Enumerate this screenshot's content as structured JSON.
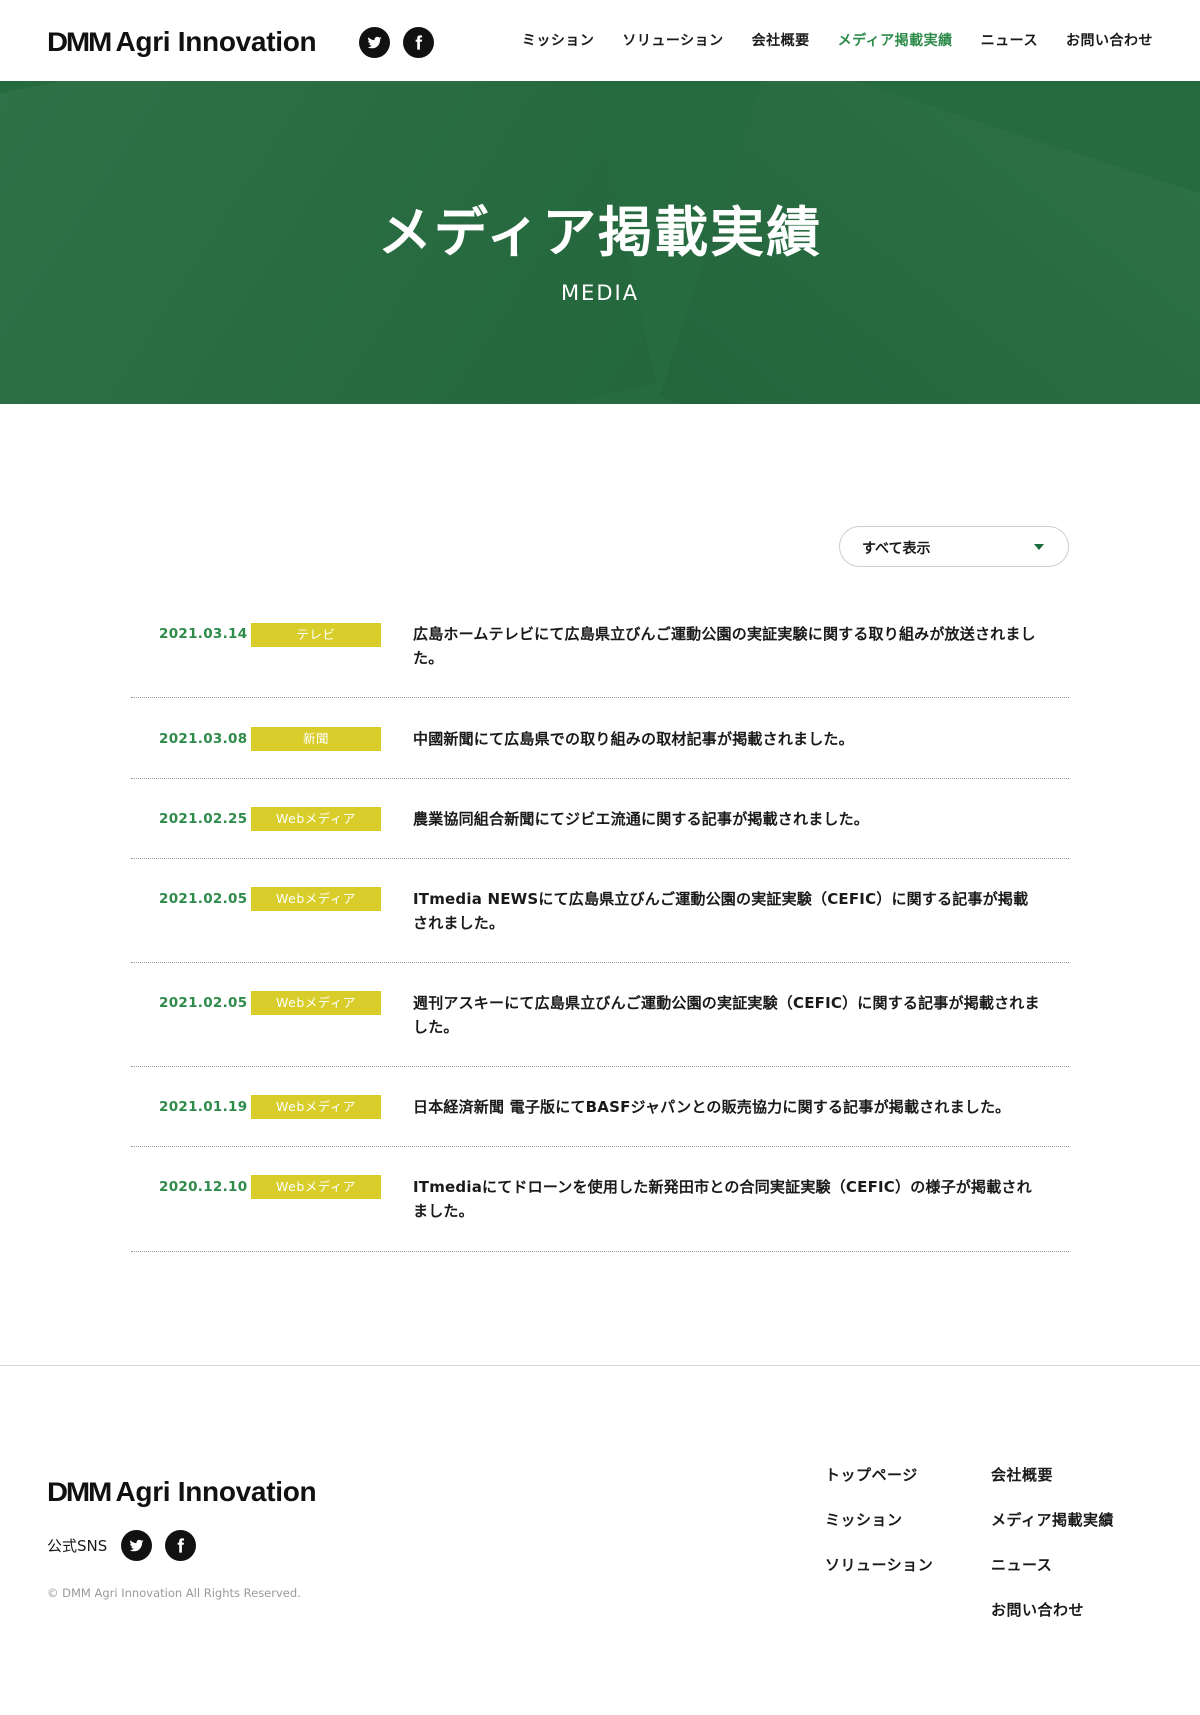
{
  "header": {
    "logo_mark": "DMM",
    "logo_text": "Agri Innovation",
    "nav": [
      {
        "label": "ミッション",
        "active": false
      },
      {
        "label": "ソリューション",
        "active": false
      },
      {
        "label": "会社概要",
        "active": false
      },
      {
        "label": "メディア掲載実績",
        "active": true
      },
      {
        "label": "ニュース",
        "active": false
      },
      {
        "label": "お問い合わせ",
        "active": false
      }
    ]
  },
  "hero": {
    "title": "メディア掲載実績",
    "subtitle": "MEDIA"
  },
  "filter": {
    "selected": "すべて表示"
  },
  "articles": [
    {
      "date": "2021.03.14",
      "category": "テレビ",
      "title": "広島ホームテレビにて広島県立びんご運動公園の実証実験に関する取り組みが放送されました。"
    },
    {
      "date": "2021.03.08",
      "category": "新聞",
      "title": "中國新聞にて広島県での取り組みの取材記事が掲載されました。"
    },
    {
      "date": "2021.02.25",
      "category": "Webメディア",
      "title": "農業協同組合新聞にてジビエ流通に関する記事が掲載されました。"
    },
    {
      "date": "2021.02.05",
      "category": "Webメディア",
      "title": "ITmedia NEWSにて広島県立びんご運動公園の実証実験（CEFIC）に関する記事が掲載されました。"
    },
    {
      "date": "2021.02.05",
      "category": "Webメディア",
      "title": "週刊アスキーにて広島県立びんご運動公園の実証実験（CEFIC）に関する記事が掲載されました。"
    },
    {
      "date": "2021.01.19",
      "category": "Webメディア",
      "title": "日本経済新聞 電子版にてBASFジャパンとの販売協力に関する記事が掲載されました。"
    },
    {
      "date": "2020.12.10",
      "category": "Webメディア",
      "title": "ITmediaにてドローンを使用した新発田市との合同実証実験（CEFIC）の様子が掲載されました。"
    }
  ],
  "footer": {
    "logo_mark": "DMM",
    "logo_text": "Agri Innovation",
    "sns_label": "公式SNS",
    "copyright": "© DMM Agri Innovation All Rights Reserved.",
    "links_col1": [
      "トップページ",
      "ミッション",
      "ソリューション"
    ],
    "links_col2": [
      "会社概要",
      "メディア掲載実績",
      "ニュース",
      "お問い合わせ"
    ]
  },
  "colors": {
    "brand_green": "#256b3f",
    "accent_green": "#2e8b4a",
    "tag_yellow": "#d8cd2a"
  },
  "icons": [
    "twitter-icon",
    "facebook-icon",
    "chevron-down-icon"
  ]
}
